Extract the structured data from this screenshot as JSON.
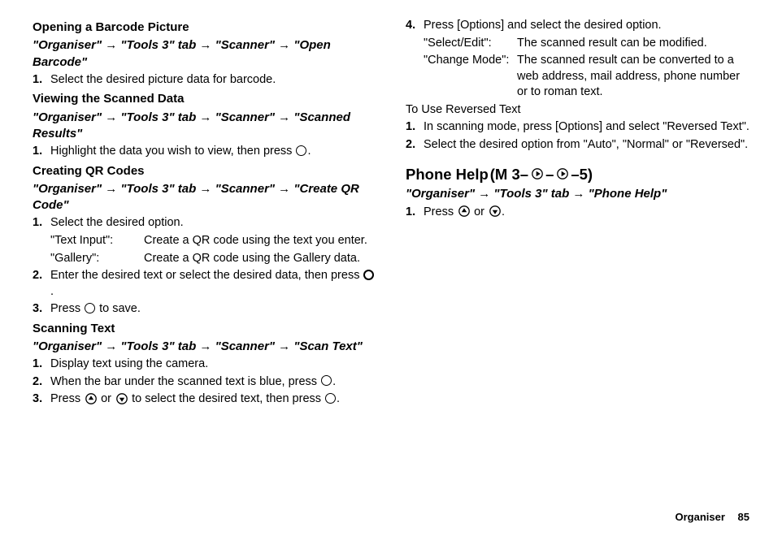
{
  "col1": {
    "h1": "Opening a Barcode Picture",
    "p1": "\"Organiser\" → \"Tools 3\" tab → \"Scanner\" → \"Open Barcode\"",
    "s1_num": "1.",
    "s1_text": "Select the desired picture data for barcode.",
    "h2": "Viewing the Scanned Data",
    "p2": "\"Organiser\" → \"Tools 3\" tab → \"Scanner\" → \"Scanned Results\"",
    "s2_num": "1.",
    "s2_text_a": "Highlight the data you wish to view, then press ",
    "s2_text_b": ".",
    "h3": "Creating QR Codes",
    "p3": "\"Organiser\" → \"Tools 3\" tab → \"Scanner\" → \"Create QR Code\"",
    "s3_num": "1.",
    "s3_text": "Select the desired option.",
    "d3a_term": "\"Text Input\":",
    "d3a_desc": "Create a QR code using the text you enter.",
    "d3b_term": "\"Gallery\":",
    "d3b_desc": "Create a QR code using the Gallery data.",
    "s4_num": "2.",
    "s4_text_a": "Enter the desired text or select the desired data, then press ",
    "s4_text_b": ".",
    "s5_num": "3.",
    "s5_text_a": "Press ",
    "s5_text_b": " to save.",
    "h4": "Scanning Text",
    "p4": "\"Organiser\" → \"Tools 3\" tab → \"Scanner\" → \"Scan Text\"",
    "s6_num": "1.",
    "s6_text": "Display text using the camera.",
    "s7_num": "2.",
    "s7_text_a": "When the bar under the scanned text is blue, press ",
    "s7_text_b": ".",
    "s8_num": "3.",
    "s8_text_a": "Press ",
    "s8_text_b": " or ",
    "s8_text_c": " to select the desired text, then press ",
    "s8_text_d": "."
  },
  "col2": {
    "s1_num": "4.",
    "s1_text": "Press [Options] and select the desired option.",
    "d1a_term": "\"Select/Edit\":",
    "d1a_desc": "The scanned result can be modified.",
    "d1b_term": "\"Change Mode\":",
    "d1b_desc": "The scanned result can be converted to a web address, mail address, phone number or to roman text.",
    "plain1": "To Use Reversed Text",
    "s2_num": "1.",
    "s2_text": "In scanning mode, press [Options] and select \"Reversed Text\".",
    "s3_num": "2.",
    "s3_text": "Select the desired option from \"Auto\", \"Normal\" or \"Reversed\".",
    "title_a": "Phone Help ",
    "title_b": "(M 3–",
    "title_c": "–",
    "title_d": "–5)",
    "p1": "\"Organiser\" → \"Tools 3\" tab → \"Phone Help\"",
    "s4_num": "1.",
    "s4_text_a": "Press ",
    "s4_text_b": " or ",
    "s4_text_c": "."
  },
  "footer": {
    "section": "Organiser",
    "page": "85"
  }
}
